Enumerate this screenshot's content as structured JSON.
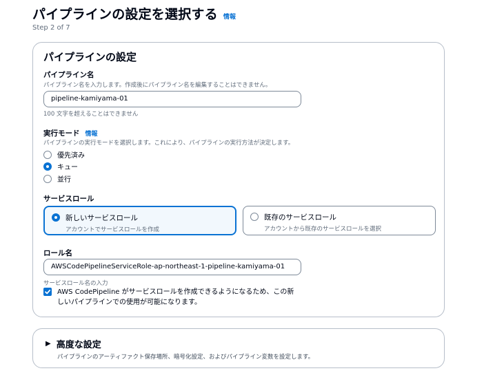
{
  "header": {
    "title": "パイプラインの設定を選択する",
    "info_link": "情報",
    "step": "Step 2 of 7"
  },
  "pipeline_settings": {
    "title": "パイプラインの設定",
    "name": {
      "label": "パイプライン名",
      "description": "パイプライン名を入力します。作成後にパイプライン名を編集することはできません。",
      "value": "pipeline-kamiyama-01",
      "constraint": "100 文字を超えることはできません"
    },
    "execution_mode": {
      "label": "実行モード",
      "info_link": "情報",
      "description": "パイプラインの実行モードを選択します。これにより、パイプラインの実行方法が決定します。",
      "options": [
        "優先済み",
        "キュー",
        "並行"
      ],
      "selected": "キュー"
    },
    "service_role": {
      "label": "サービスロール",
      "new_role": {
        "title": "新しいサービスロール",
        "description": "アカウントでサービスロールを作成"
      },
      "existing_role": {
        "title": "既存のサービスロール",
        "description": "アカウントから既存のサービスロールを選択"
      },
      "selected": "新しいサービスロール"
    },
    "role_name": {
      "label": "ロール名",
      "value": "AWSCodePipelineServiceRole-ap-northeast-1-pipeline-kamiyama-01",
      "hint": "サービスロール名の入力",
      "checkbox_label_line1": "AWS CodePipeline がサービスロールを作成できるようになるため、この新",
      "checkbox_label_line2": "しいパイプラインでの使用が可能になります。",
      "checkbox_checked": true
    }
  },
  "advanced": {
    "caret": "▶",
    "title": "高度な設定",
    "description": "パイプラインのアーティファクト保存場所、暗号化設定、およびパイプライン変数を設定します。"
  },
  "colors": {
    "accent": "#0972d3",
    "border": "#b6bec9",
    "muted_text": "#5f6b7a"
  }
}
